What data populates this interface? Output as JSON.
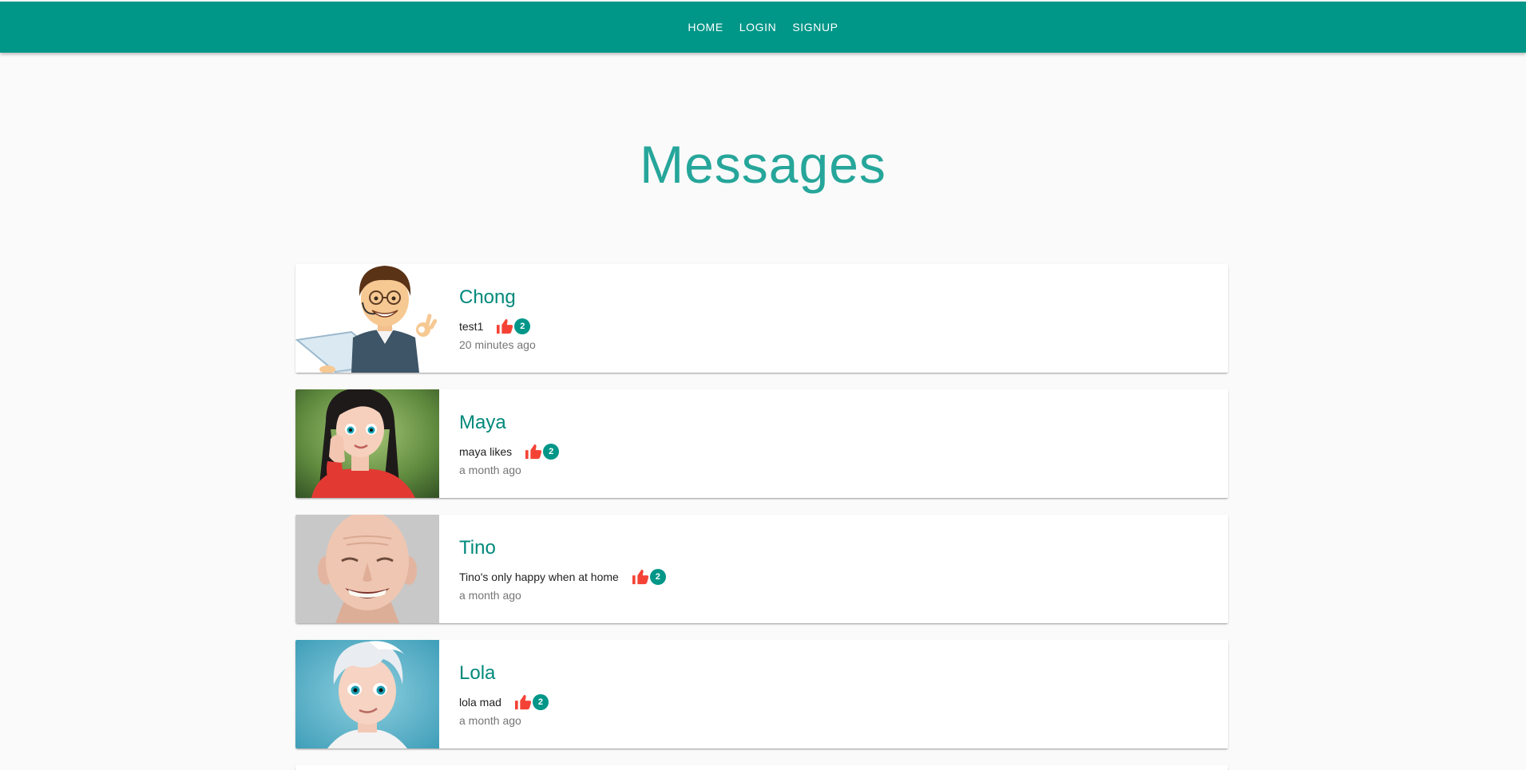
{
  "nav": {
    "home": "HOME",
    "login": "LOGIN",
    "signup": "SIGNUP"
  },
  "page_title": "Messages",
  "messages": [
    {
      "name": "Chong",
      "text": "test1",
      "likes": "2",
      "time": "20 minutes ago"
    },
    {
      "name": "Maya",
      "text": "maya likes",
      "likes": "2",
      "time": "a month ago"
    },
    {
      "name": "Tino",
      "text": "Tino's only happy when at home",
      "likes": "2",
      "time": "a month ago"
    },
    {
      "name": "Lola",
      "text": "lola mad",
      "likes": "2",
      "time": "a month ago"
    }
  ],
  "icons": {
    "like": "thumbs-up-icon"
  },
  "colors": {
    "primary": "#009688",
    "title": "#26a69a",
    "name": "#00897b",
    "like": "#f44336"
  }
}
